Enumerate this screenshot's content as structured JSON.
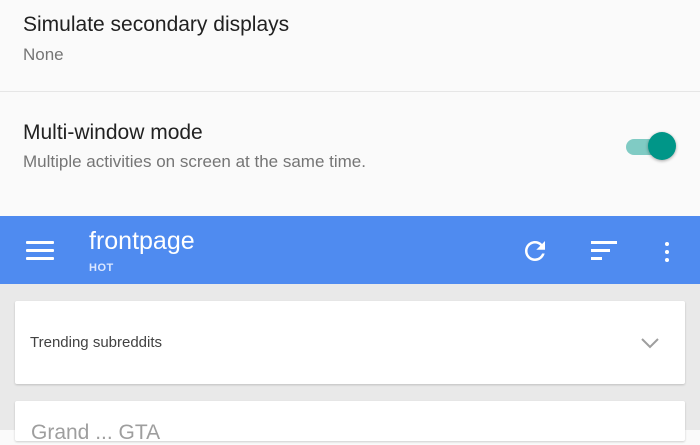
{
  "settings": {
    "secondary_displays": {
      "title": "Simulate secondary displays",
      "summary": "None"
    },
    "multi_window": {
      "title": "Multi-window mode",
      "summary": "Multiple activities on screen at the same time.",
      "enabled": true
    }
  },
  "appbar": {
    "title": "frontpage",
    "subtitle": "HOT",
    "background_color": "#4f8bf0",
    "icons": [
      "menu-icon",
      "refresh-icon",
      "sort-icon",
      "more-vert-icon"
    ]
  },
  "feed": {
    "trending_label": "Trending subreddits",
    "post_title_partial": "Grand ... GTA"
  },
  "colors": {
    "toggle_thumb": "#009688",
    "toggle_track": "#80cbc4"
  }
}
